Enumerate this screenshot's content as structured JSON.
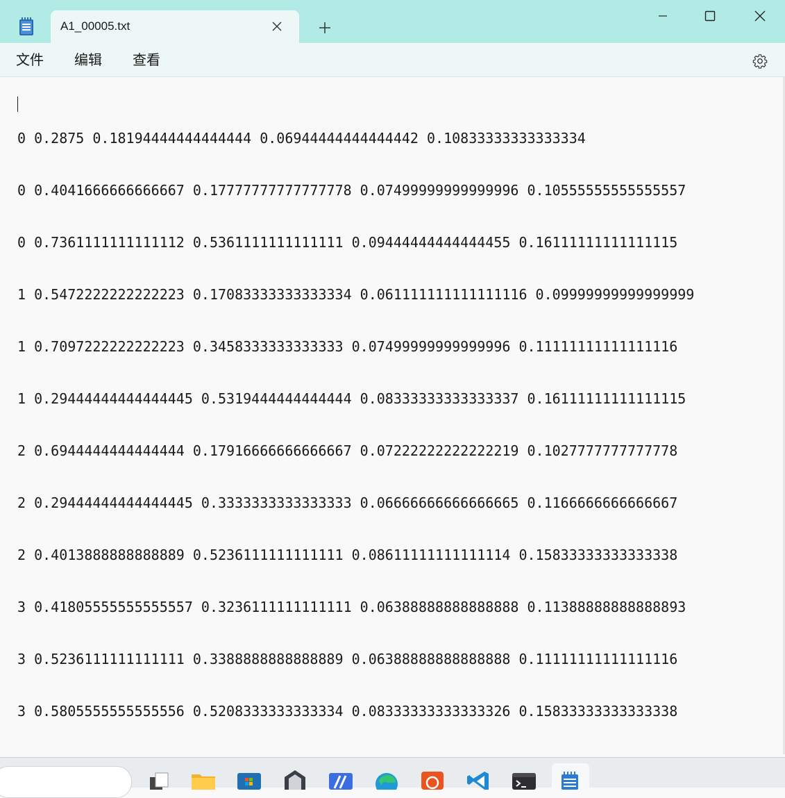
{
  "window": {
    "tab_title": "A1_00005.txt",
    "new_tab_label": "+"
  },
  "menu": {
    "file": "文件",
    "edit": "编辑",
    "view": "查看"
  },
  "editor": {
    "lines": [
      "0 0.2875 0.18194444444444444 0.06944444444444442 0.10833333333333334",
      "0 0.4041666666666667 0.17777777777777778 0.07499999999999996 0.10555555555555557",
      "0 0.7361111111111112 0.5361111111111111 0.09444444444444455 0.16111111111111115",
      "1 0.5472222222222223 0.17083333333333334 0.061111111111111116 0.09999999999999999",
      "1 0.7097222222222223 0.3458333333333333 0.07499999999999996 0.11111111111111116",
      "1 0.29444444444444445 0.5319444444444444 0.08333333333333337 0.16111111111111115",
      "2 0.6944444444444444 0.17916666666666667 0.07222222222222219 0.1027777777777778",
      "2 0.29444444444444445 0.3333333333333333 0.06666666666666665 0.1166666666666667",
      "2 0.4013888888888889 0.5236111111111111 0.08611111111111114 0.15833333333333338",
      "3 0.41805555555555557 0.3236111111111111 0.06388888888888888 0.11388888888888893",
      "3 0.5236111111111111 0.3388888888888889 0.06388888888888888 0.11111111111111116",
      "3 0.5805555555555556 0.5208333333333334 0.08333333333333326 0.15833333333333338"
    ]
  },
  "icons": {
    "app": "notepad-icon",
    "close_tab": "close-icon",
    "new_tab": "plus-icon",
    "minimize": "minimize-icon",
    "maximize": "maximize-icon",
    "close_window": "close-icon",
    "settings": "gear-icon"
  },
  "taskbar": {
    "apps": [
      "task-view-icon",
      "file-explorer-icon",
      "microsoft-store-icon",
      "dev-app-icon",
      "visual-studio-icon",
      "edge-icon",
      "ubuntu-icon",
      "vscode-icon",
      "terminal-icon",
      "notepad-icon"
    ]
  },
  "colors": {
    "titlebar": "#b2ebe6",
    "tab": "#ecf7f6",
    "editor_bg": "#f9f9f9",
    "text": "#1a1a1a"
  }
}
